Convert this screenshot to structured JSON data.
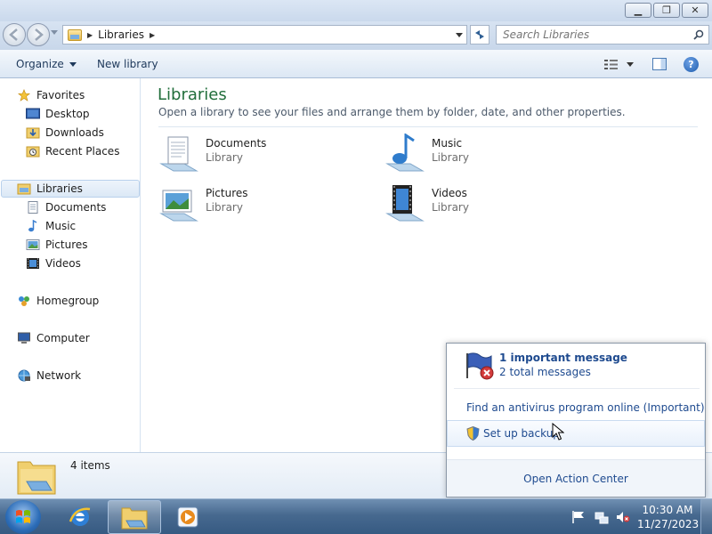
{
  "window": {
    "minimize_glyph": "▁",
    "maximize_glyph": "❐",
    "close_glyph": "✕"
  },
  "address": {
    "breadcrumb": [
      "Libraries"
    ],
    "search_placeholder": "Search Libraries"
  },
  "toolbar": {
    "organize_label": "Organize",
    "new_library_label": "New library"
  },
  "nav": {
    "favorites": {
      "label": "Favorites",
      "items": [
        "Desktop",
        "Downloads",
        "Recent Places"
      ]
    },
    "libraries": {
      "label": "Libraries",
      "items": [
        "Documents",
        "Music",
        "Pictures",
        "Videos"
      ]
    },
    "homegroup_label": "Homegroup",
    "computer_label": "Computer",
    "network_label": "Network"
  },
  "main": {
    "title": "Libraries",
    "description": "Open a library to see your files and arrange them by folder, date, and other properties.",
    "libraries": [
      {
        "name": "Documents",
        "type": "Library",
        "icon": "documents-library-icon"
      },
      {
        "name": "Music",
        "type": "Library",
        "icon": "music-library-icon"
      },
      {
        "name": "Pictures",
        "type": "Library",
        "icon": "pictures-library-icon"
      },
      {
        "name": "Videos",
        "type": "Library",
        "icon": "videos-library-icon"
      }
    ]
  },
  "details": {
    "item_count": "4 items"
  },
  "action_center": {
    "title": "1 important message",
    "subtitle": "2 total messages",
    "link_antivirus": "Find an antivirus program online (Important)",
    "link_backup": "Set up backup",
    "open_label": "Open Action Center"
  },
  "taskbar": {
    "time": "10:30 AM",
    "date": "11/27/2023"
  },
  "colors": {
    "title_green": "#216e3b",
    "link_blue": "#1e4a8f",
    "taskbar_blue": "#47698f"
  }
}
